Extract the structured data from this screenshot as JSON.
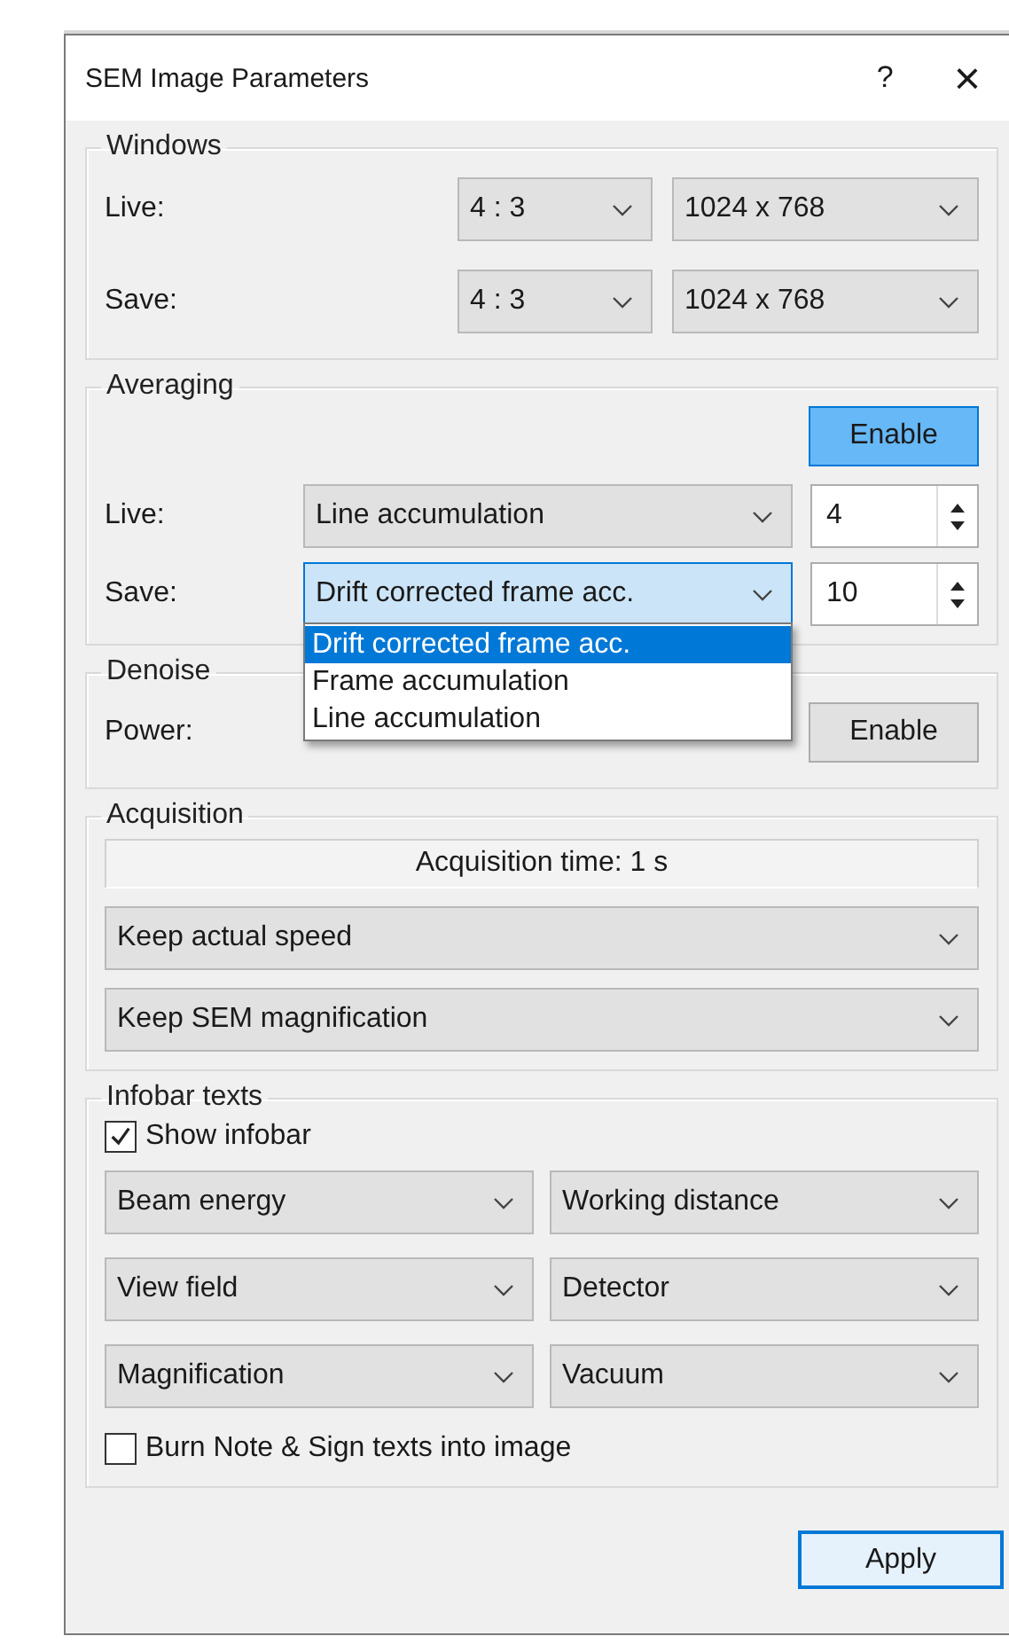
{
  "window": {
    "title": "SEM Image Parameters",
    "help": "?",
    "close": "×"
  },
  "windows": {
    "title": "Windows",
    "rows": [
      {
        "label": "Live:",
        "aspect": "4 : 3",
        "resolution": "1024 x 768"
      },
      {
        "label": "Save:",
        "aspect": "4 : 3",
        "resolution": "1024 x 768"
      }
    ]
  },
  "averaging": {
    "title": "Averaging",
    "enable": {
      "label": "Enable",
      "on": true
    },
    "rows": [
      {
        "label": "Live:",
        "mode": "Line accumulation",
        "count": "4",
        "open": false
      },
      {
        "label": "Save:",
        "mode": "Drift corrected frame acc.",
        "count": "10",
        "open": true
      }
    ],
    "options": [
      {
        "label": "Drift corrected frame acc.",
        "selected": true
      },
      {
        "label": "Frame accumulation",
        "selected": false
      },
      {
        "label": "Line accumulation",
        "selected": false
      }
    ]
  },
  "denoise": {
    "title": "Denoise",
    "power_label": "Power:",
    "enable": {
      "label": "Enable",
      "on": false
    }
  },
  "acquisition": {
    "title": "Acquisition",
    "time": "Acquisition time: 1 s",
    "dropdowns": [
      "Keep actual speed",
      "Keep SEM magnification"
    ]
  },
  "infobar": {
    "title": "Infobar texts",
    "show": {
      "label": "Show infobar",
      "checked": true
    },
    "fields": [
      "Beam energy",
      "Working distance",
      "View field",
      "Detector",
      "Magnification",
      "Vacuum"
    ],
    "burn": {
      "label": "Burn Note & Sign texts into image",
      "checked": false
    }
  },
  "buttons": [
    {
      "label": "Apply",
      "focused": true
    }
  ]
}
